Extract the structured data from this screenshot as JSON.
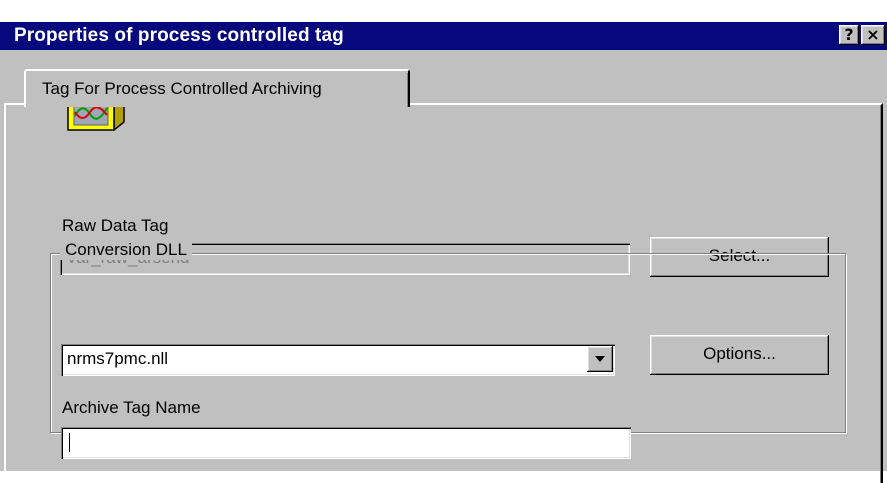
{
  "window": {
    "title": "Properties of process controlled tag",
    "help_label": "?",
    "close_label": "×"
  },
  "tabs": [
    {
      "label": "Tag For Process Controlled Archiving",
      "selected": true
    }
  ],
  "raw_data_tag": {
    "label": "Raw Data Tag",
    "value": "Var_raw_arsend",
    "enabled": false,
    "select_button": "Select..."
  },
  "conversion_dll": {
    "group_label": "Conversion DLL",
    "selected": "nrms7pmc.nll",
    "options_button": "Options..."
  },
  "archive_tag_name": {
    "label": "Archive Tag Name",
    "value": ""
  },
  "icons": {
    "tag_type_icon": "archive-curve-icon",
    "dropdown_arrow": "chevron-down-icon"
  },
  "colors": {
    "titlebar": "#06087c",
    "face": "#c0c0c0",
    "icon_yellow": "#ffff00",
    "icon_curve_green": "#00a000",
    "icon_curve_red": "#e00000"
  }
}
